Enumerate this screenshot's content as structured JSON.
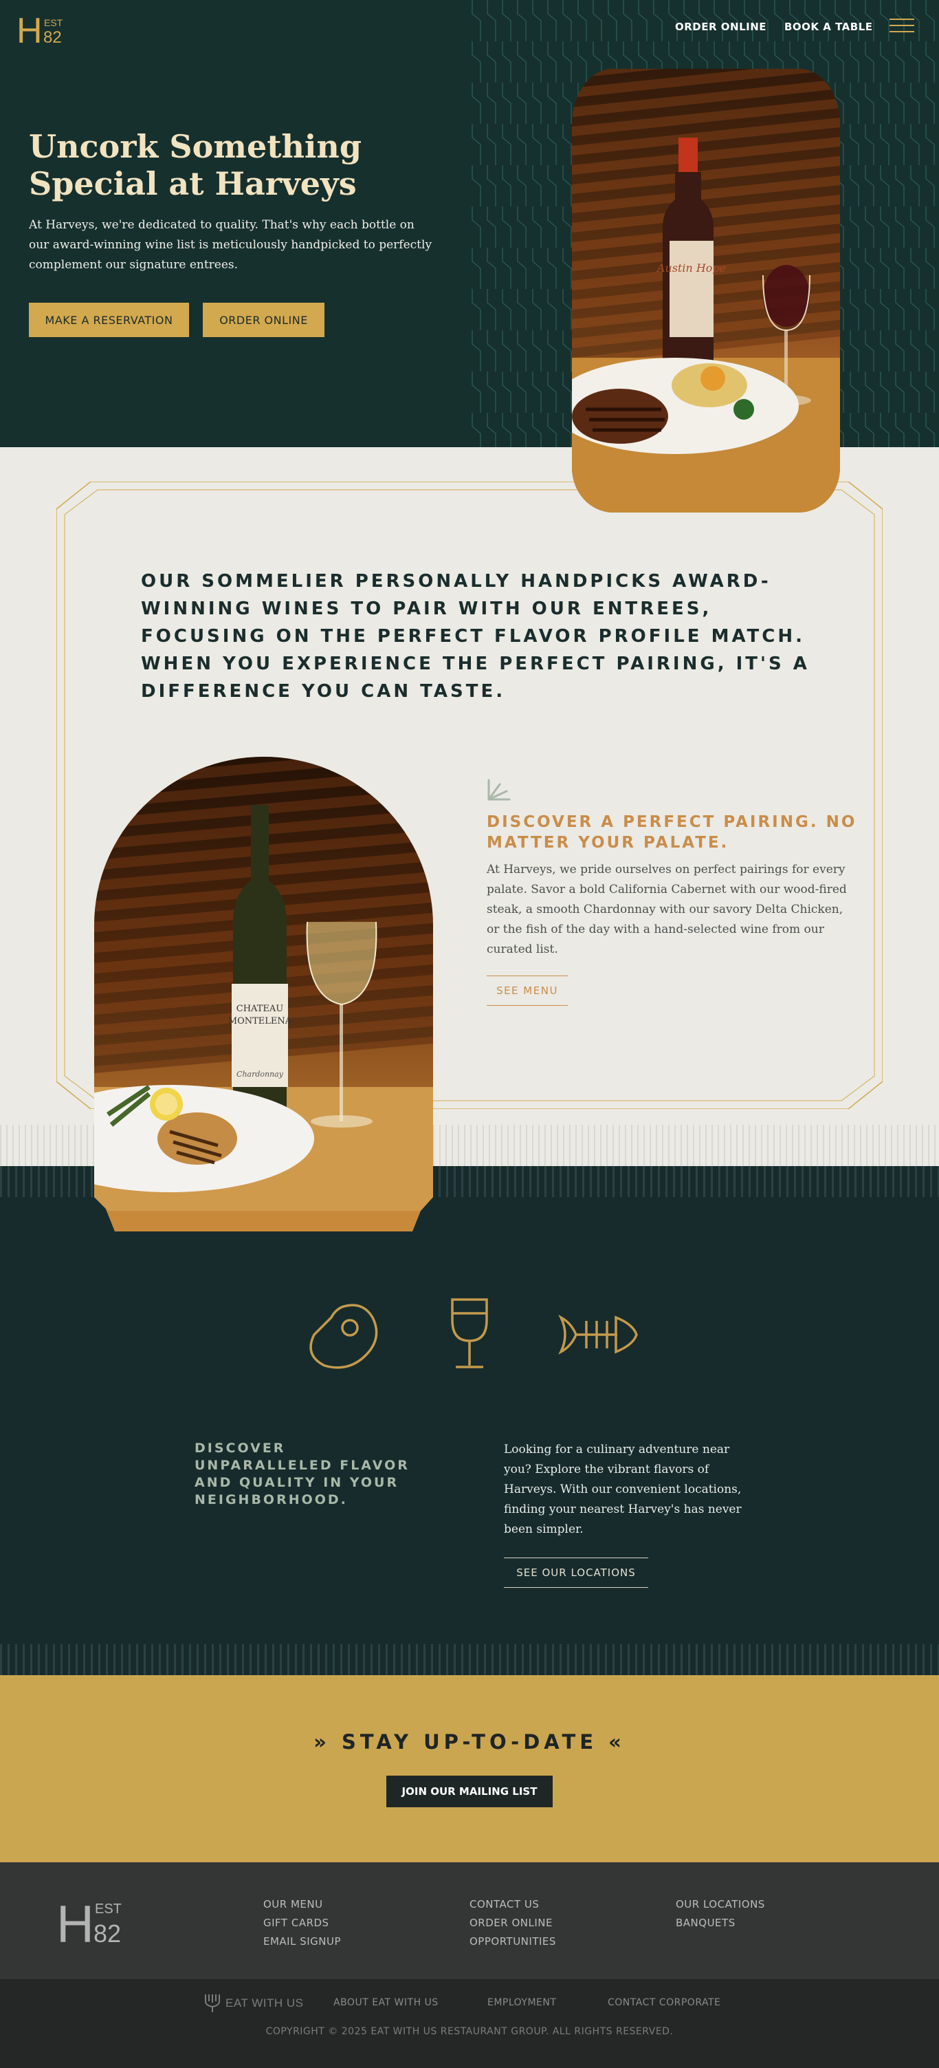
{
  "brand": {
    "logo_letter": "H",
    "logo_est": "EST",
    "logo_year": "82"
  },
  "nav": {
    "order_online": "ORDER ONLINE",
    "book_table": "BOOK A TABLE"
  },
  "hero": {
    "title_line1": "Uncork Something",
    "title_line2": "Special at Harveys",
    "body": "At Harveys, we're dedicated to quality. That's why each bottle on our award-winning wine list is meticulously handpicked to perfectly complement our signature entrees.",
    "cta_reservation": "MAKE A RESERVATION",
    "cta_order": "ORDER ONLINE",
    "bottle_label": "Austin Hope"
  },
  "sommelier": {
    "quote": "OUR SOMMELIER PERSONALLY HANDPICKS AWARD-WINNING WINES TO PAIR WITH OUR ENTREES, FOCUSING ON THE PERFECT FLAVOR PROFILE MATCH. WHEN YOU EXPERIENCE THE PERFECT PAIRING, IT'S A DIFFERENCE YOU CAN TASTE.",
    "bottle_label_1": "CHATEAU",
    "bottle_label_2": "MONTELENA",
    "bottle_label_3": "Chardonnay"
  },
  "pairing": {
    "title": "DISCOVER A PERFECT PAIRING. NO MATTER YOUR PALATE.",
    "body": "At Harveys, we pride ourselves on perfect pairings for every palate. Savor a bold California Cabernet with our wood-fired steak, a smooth Chardonnay with our savory Delta Chicken, or the fish of the day with a hand-selected wine from our curated list.",
    "cta": "SEE MENU"
  },
  "discover": {
    "title": "DISCOVER UNPARALLELED FLAVOR AND QUALITY IN YOUR NEIGHBORHOOD.",
    "body": "Looking for a culinary adventure near you? Explore the vibrant flavors of Harveys. With our convenient locations, finding your nearest Harvey's has never been simpler.",
    "cta": "SEE OUR LOCATIONS",
    "icons": [
      "steak-icon",
      "wine-glass-icon",
      "fish-icon"
    ]
  },
  "newsletter": {
    "left_quote": "»",
    "title": "STAY UP-TO-DATE",
    "right_quote": "«",
    "cta": "JOIN OUR MAILING LIST"
  },
  "footer": {
    "col1": [
      "OUR MENU",
      "GIFT CARDS",
      "EMAIL SIGNUP"
    ],
    "col2": [
      "CONTACT US",
      "ORDER ONLINE",
      "OPPORTUNITIES"
    ],
    "col3": [
      "OUR LOCATIONS",
      "BANQUETS"
    ]
  },
  "subfooter": {
    "brand": "EAT WITH US",
    "links": [
      "ABOUT EAT WITH US",
      "EMPLOYMENT",
      "CONTACT CORPORATE"
    ],
    "copyright": "COPYRIGHT © 2025 EAT WITH US RESTAURANT GROUP. ALL RIGHTS RESERVED."
  },
  "colors": {
    "dark_green": "#16302e",
    "gold": "#d3a94f",
    "cream": "#ebeae4",
    "copper": "#c98d4a",
    "charcoal": "#343535"
  }
}
